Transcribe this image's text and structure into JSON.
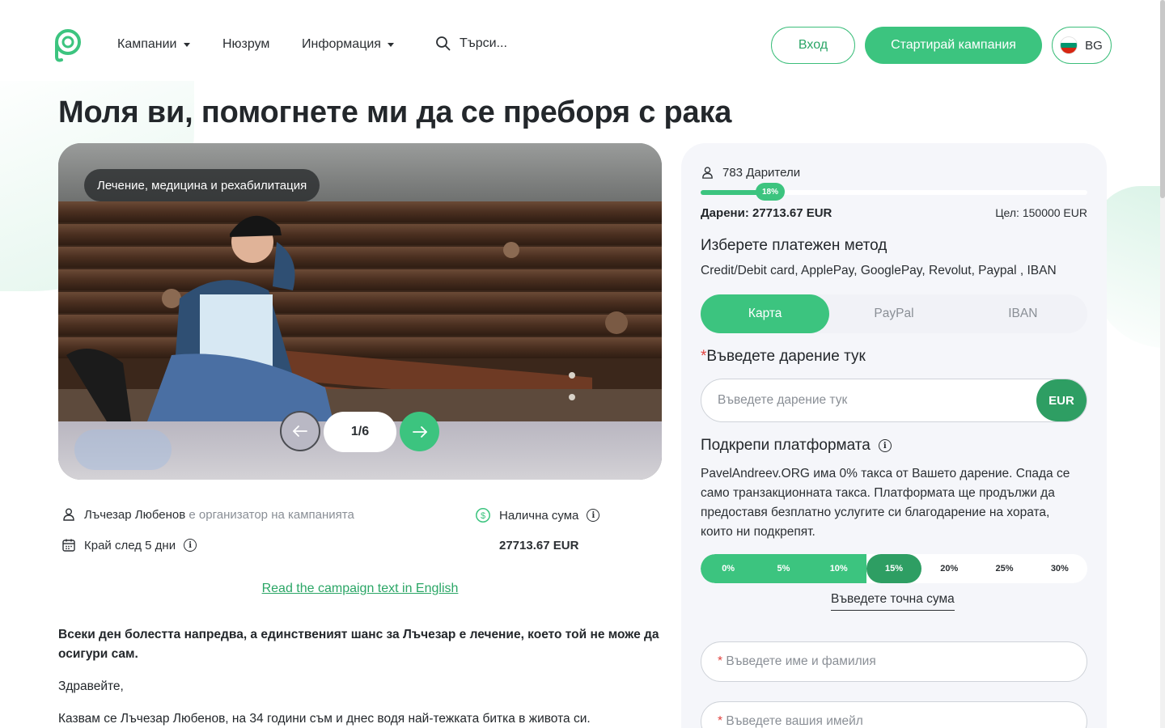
{
  "header": {
    "nav": [
      {
        "label": "Кампании",
        "dropdown": true
      },
      {
        "label": "Нюзрум",
        "dropdown": false
      },
      {
        "label": "Информация",
        "dropdown": true
      }
    ],
    "search_label": "Търси...",
    "login_label": "Вход",
    "start_campaign_label": "Стартирай кампания",
    "language": "BG"
  },
  "campaign": {
    "title": "Моля ви, помогнете ми да се преборя с рака",
    "category": "Лечение, медицина и рехабилитация",
    "gallery_counter": "1/6",
    "organizer_name": "Лъчезар Любенов",
    "organizer_role": "е организатор на кампанията",
    "ends_in": "Край след 5 дни",
    "available_label": "Налична сума",
    "available_amount": "27713.67 EUR",
    "english_link": "Read the campaign text in English",
    "story": [
      "Всеки ден болестта напредва, а единственият шанс за Лъчезар е лечение, което той не може да осигури сам.",
      "Здравейте,",
      "Казвам се Лъчезар Любенов, на 34 години съм и днес водя най-тежката битка в живота си."
    ]
  },
  "donation": {
    "donors": "783 Дарители",
    "progress_percent": 18,
    "progress_label": "18%",
    "raised_label": "Дарени:",
    "raised_amount": "27713.67 EUR",
    "goal": "Цел: 150000 EUR",
    "payment_heading": "Изберете платежен метод",
    "payment_methods": "Credit/Debit card, ApplePay, GooglePay, Revolut, Paypal , IBAN",
    "tabs": [
      "Карта",
      "PayPal",
      "IBAN"
    ],
    "active_tab": "Карта",
    "amount_heading": "Въведете дарение тук",
    "amount_placeholder": "Въведете дарение тук",
    "currency": "EUR",
    "platform_heading": "Подкрепи платформата",
    "platform_text": "PavelAndreev.ORG има 0% такса от Вашето дарение. Спада се само транзакционната такса. Платформата ще продължи да предоставя безплатно услугите си благодарение на хората, които ни подкрепят.",
    "tips": [
      "0%",
      "5%",
      "10%",
      "15%",
      "20%",
      "25%",
      "30%"
    ],
    "selected_tip": "15%",
    "exact_amount_label": "Въведете точна сума",
    "name_placeholder": "Въведете име и фамилия",
    "email_placeholder": "Въведете вашия имейл"
  },
  "colors": {
    "accent": "#3cc47f",
    "accent_dark": "#2e9e63",
    "panel_bg": "#f5f6fa",
    "required": "#e0423f"
  }
}
